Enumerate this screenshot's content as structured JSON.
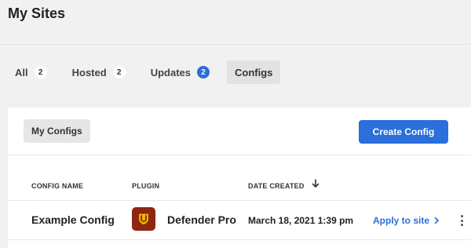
{
  "page": {
    "title": "My Sites"
  },
  "tabs": [
    {
      "label": "All",
      "badge": "2",
      "active": false
    },
    {
      "label": "Hosted",
      "badge": "2",
      "active": false
    },
    {
      "label": "Updates",
      "badge": "2",
      "active": false,
      "badge_style": "blue"
    },
    {
      "label": "Configs",
      "active": true
    }
  ],
  "configs_panel": {
    "filter_label": "My Configs",
    "create_label": "Create Config",
    "columns": {
      "name": "CONFIG NAME",
      "plugin": "PLUGIN",
      "date": "DATE CREATED"
    },
    "sort": {
      "column": "date",
      "direction": "desc",
      "icon": "arrow-down-icon"
    },
    "rows": [
      {
        "name": "Example Config",
        "plugin_name": "Defender Pro",
        "plugin_icon": "defender-shield-icon",
        "date_created": "March 18, 2021 1:39 pm",
        "action_label": "Apply to site"
      }
    ]
  },
  "colors": {
    "accent": "#2a6fdb",
    "plugin_icon_bg": "#8c2711",
    "page_bg": "#f1f1f1",
    "panel_bg": "#ffffff"
  }
}
